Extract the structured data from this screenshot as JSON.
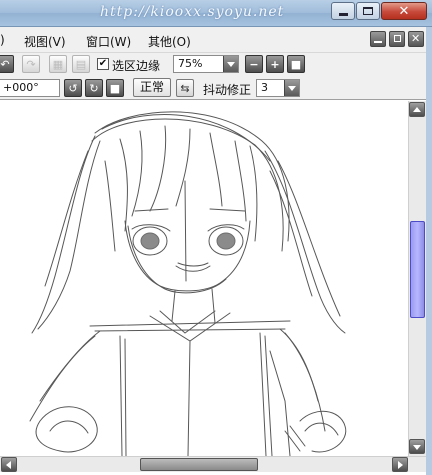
{
  "window": {
    "title": "http://kiooxx.syoyu.net",
    "caption_buttons": [
      "minimize",
      "maximize",
      "close"
    ]
  },
  "menubar": {
    "truncated_left": ")",
    "items": [
      {
        "label": "视图(V)"
      },
      {
        "label": "窗口(W)"
      },
      {
        "label": "其他(O)"
      }
    ]
  },
  "toolbar1": {
    "selection_edge_checked": true,
    "selection_edge_label": "选区边缘",
    "zoom_value": "75%"
  },
  "toolbar2": {
    "rotation_value": "+000°",
    "mode_button": "正常",
    "stabilizer_label": "抖动修正",
    "stabilizer_value": "3"
  },
  "canvas": {
    "content": "pencil sketch of anime character"
  },
  "scroll": {
    "vertical_position": 0.38,
    "horizontal_position": 0.42
  }
}
